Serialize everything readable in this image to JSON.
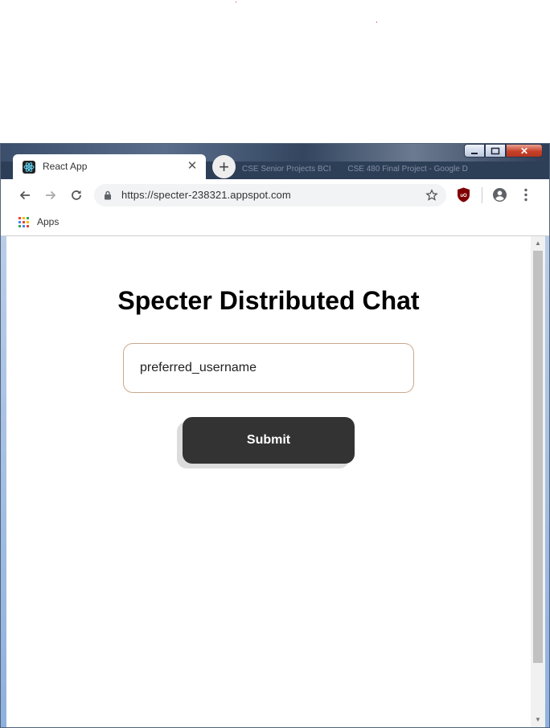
{
  "browser": {
    "tab": {
      "title": "React App",
      "favicon": "react-logo-icon"
    },
    "background_tabs": [
      "CSE Senior Projects BCI",
      "CSE 480 Final Project - Google D"
    ],
    "address_bar": {
      "url": "https://specter-238321.appspot.com"
    },
    "bookmarks": [
      {
        "label": "Apps"
      }
    ],
    "window_controls": [
      "minimize",
      "maximize",
      "close"
    ]
  },
  "page": {
    "title": "Specter Distributed Chat",
    "username_input": {
      "value": "preferred_username"
    },
    "submit_label": "Submit"
  },
  "colors": {
    "submit_background": "#333333",
    "input_border": "#c9a98f",
    "ublock": "#800000"
  }
}
